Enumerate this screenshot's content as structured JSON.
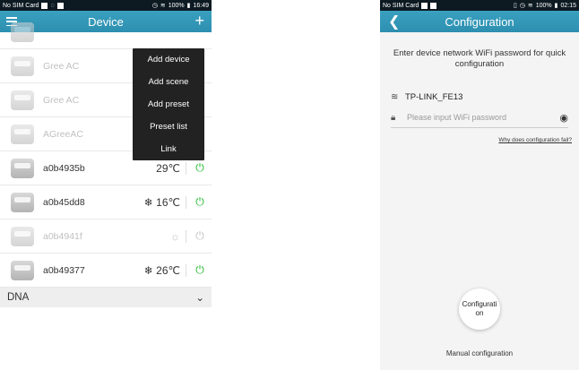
{
  "left": {
    "statusbar": {
      "carrier": "No SIM Card",
      "battery": "100%",
      "time": "16:49"
    },
    "header": {
      "title": "Device"
    },
    "menu": [
      "Add device",
      "Add scene",
      "Add preset",
      "Preset list",
      "Link"
    ],
    "devices": [
      {
        "name": "",
        "temp": ""
      },
      {
        "name": "Gree AC",
        "temp": ""
      },
      {
        "name": "Gree AC",
        "temp": ""
      },
      {
        "name": "AGreeAC",
        "temp": ""
      },
      {
        "name": "a0b4935b",
        "temp": "29℃"
      },
      {
        "name": "a0b45dd8",
        "temp": "❄ 16℃"
      },
      {
        "name": "a0b4941f",
        "temp": "☼"
      },
      {
        "name": "a0b49377",
        "temp": "❄ 26℃"
      }
    ],
    "group": {
      "label": "DNA"
    }
  },
  "right": {
    "statusbar": {
      "carrier": "No SIM Card",
      "battery": "100%",
      "time": "02:15"
    },
    "header": {
      "title": "Configuration"
    },
    "hint": "Enter device network WiFi password for quick configuration",
    "ssid": "TP-LINK_FE13",
    "password": {
      "placeholder": "Please input WiFi password"
    },
    "why_link": "Why does configuration fail?",
    "config_button": "Configuration",
    "manual": "Manual configuration"
  },
  "colors": {
    "accent": "#2d8fb0",
    "power_on": "#1fb52a",
    "menu_bg": "#222222"
  }
}
